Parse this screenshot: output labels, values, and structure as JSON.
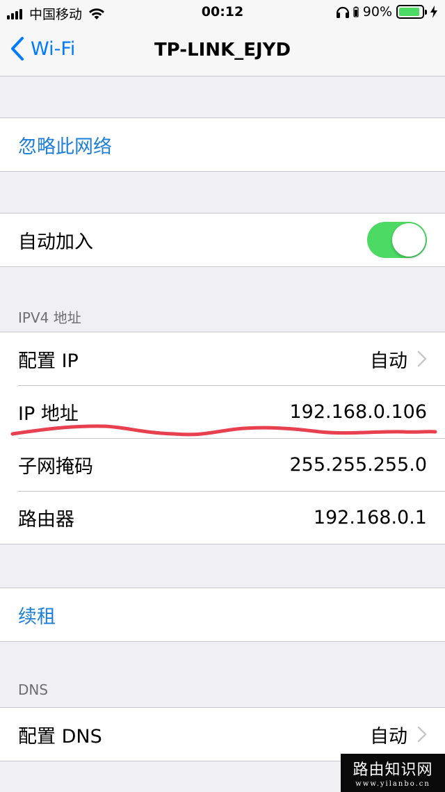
{
  "status_bar": {
    "carrier": "中国移动",
    "time": "00:12",
    "battery_percent": "90%",
    "battery_level": 0.9,
    "icons": [
      "signal-icon",
      "wifi-icon",
      "headphone-icon",
      "battery-icon",
      "charging-icon"
    ]
  },
  "nav": {
    "back_label": "Wi-Fi",
    "title": "TP-LINK_EJYD"
  },
  "forget_network": {
    "label": "忽略此网络"
  },
  "auto_join": {
    "label": "自动加入",
    "on": true
  },
  "ipv4": {
    "header": "IPV4 地址",
    "configure_ip": {
      "label": "配置 IP",
      "value": "自动"
    },
    "ip_address": {
      "label": "IP 地址",
      "value": "192.168.0.106"
    },
    "subnet_mask": {
      "label": "子网掩码",
      "value": "255.255.255.0"
    },
    "router": {
      "label": "路由器",
      "value": "192.168.0.1"
    }
  },
  "renew_lease": {
    "label": "续租"
  },
  "dns": {
    "header": "DNS",
    "configure_dns": {
      "label": "配置 DNS",
      "value": "自动"
    }
  },
  "watermark": {
    "title": "路由知识网",
    "url": "www.yilanbo.cn"
  },
  "colors": {
    "accent": "#007aff",
    "link": "#1e7fd9",
    "toggle_on": "#4cd964",
    "background": "#efeff4",
    "annotation": "#e8404f"
  }
}
